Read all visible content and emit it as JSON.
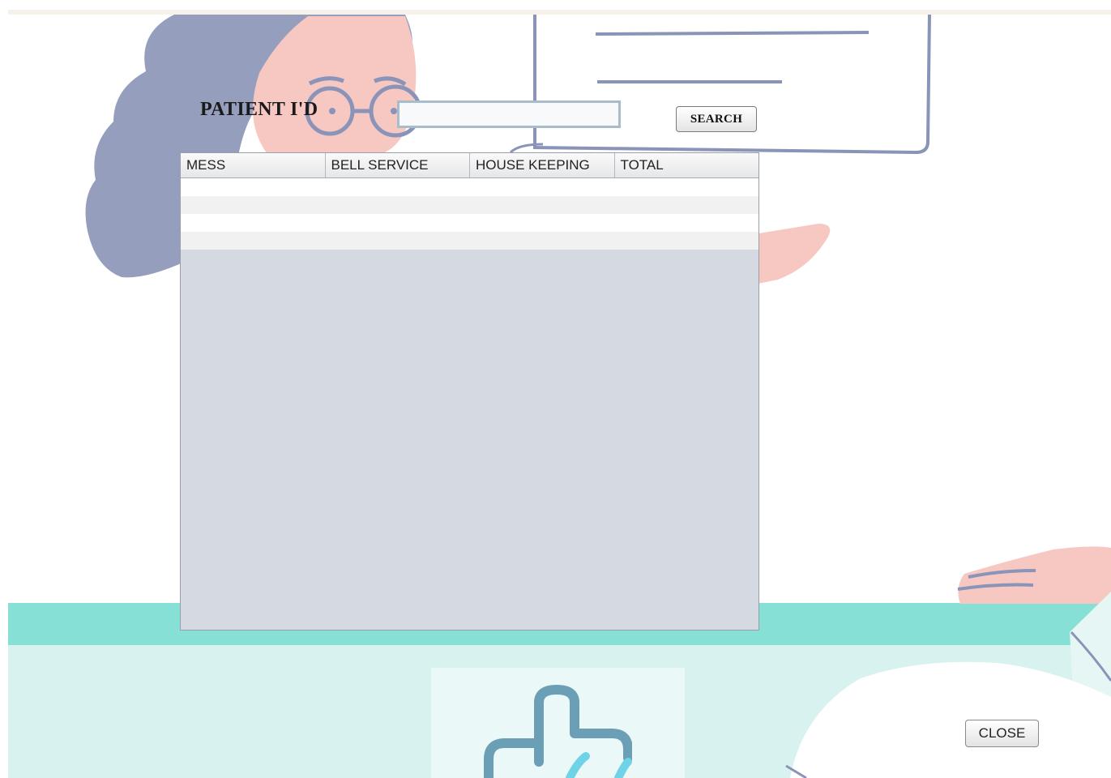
{
  "form": {
    "patient_id_label": "PATIENT I'D",
    "patient_id_value": "",
    "search_label": "SEARCH",
    "close_label": "CLOSE"
  },
  "table": {
    "columns": [
      "MESS",
      "BELL SERVICE",
      "HOUSE KEEPING",
      "TOTAL"
    ],
    "rows": [
      [
        "",
        "",
        "",
        ""
      ],
      [
        "",
        "",
        "",
        ""
      ],
      [
        "",
        "",
        "",
        ""
      ],
      [
        "",
        "",
        "",
        ""
      ]
    ]
  },
  "colors": {
    "counter_top": "#86e0d5",
    "counter_front": "#d8f2f0",
    "hair": "#959fbd",
    "skin": "#f7c8c2",
    "outline": "#8a93b8",
    "table_background": "#d5d9e2"
  },
  "icons": [
    "medical-cross-icon"
  ]
}
